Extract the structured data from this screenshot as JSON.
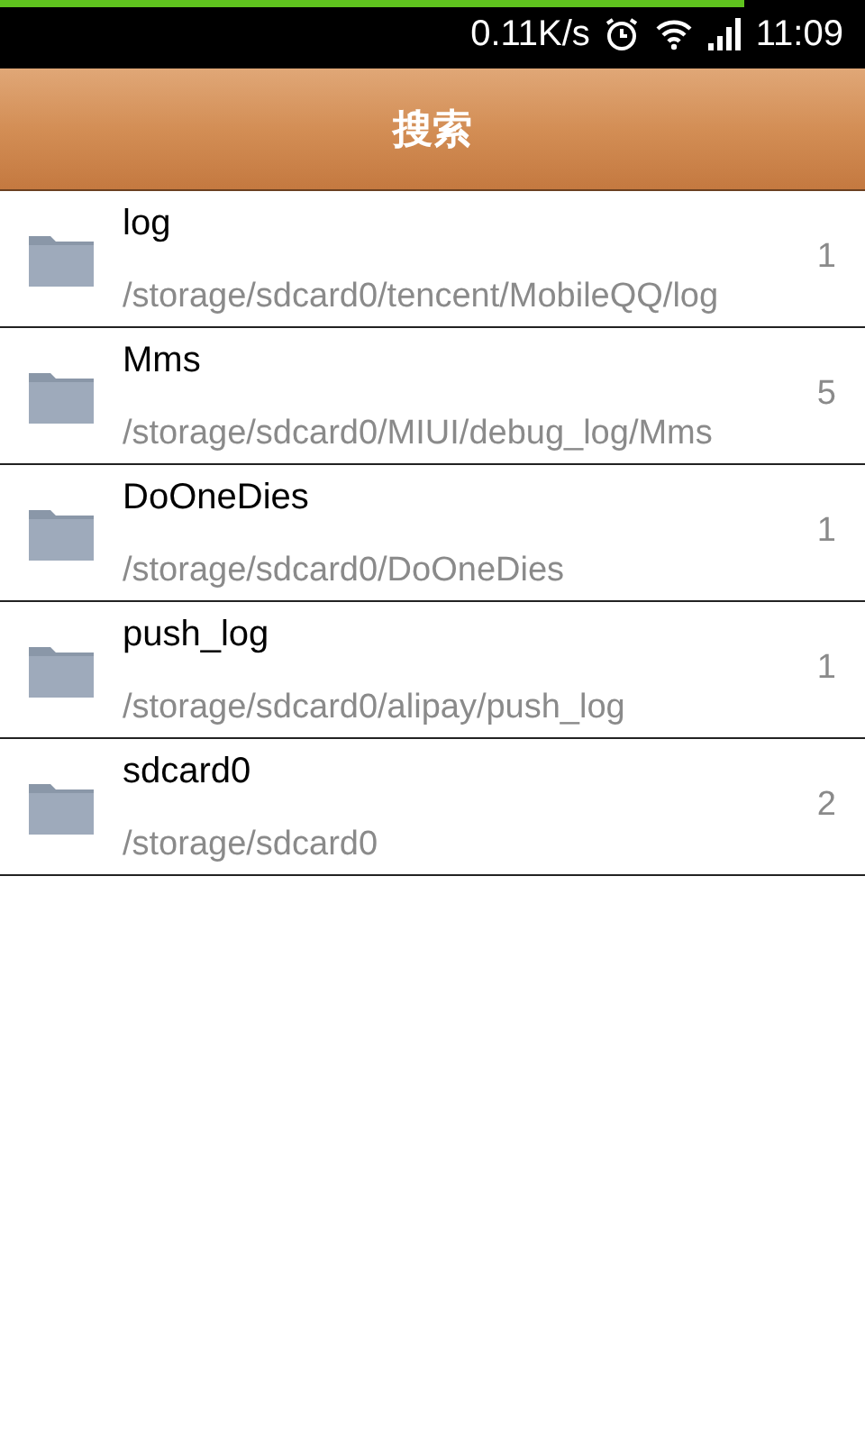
{
  "status_bar": {
    "progress": {
      "level": 0.86
    },
    "speed": "0.11K/s",
    "time": "11:09"
  },
  "header": {
    "title": "搜索"
  },
  "results": [
    {
      "name": "log",
      "path": "/storage/sdcard0/tencent/MobileQQ/log",
      "count": "1"
    },
    {
      "name": "Mms",
      "path": "/storage/sdcard0/MIUI/debug_log/Mms",
      "count": "5"
    },
    {
      "name": "DoOneDies",
      "path": "/storage/sdcard0/DoOneDies",
      "count": "1"
    },
    {
      "name": "push_log",
      "path": "/storage/sdcard0/alipay/push_log",
      "count": "1"
    },
    {
      "name": "sdcard0",
      "path": "/storage/sdcard0",
      "count": "2"
    }
  ]
}
